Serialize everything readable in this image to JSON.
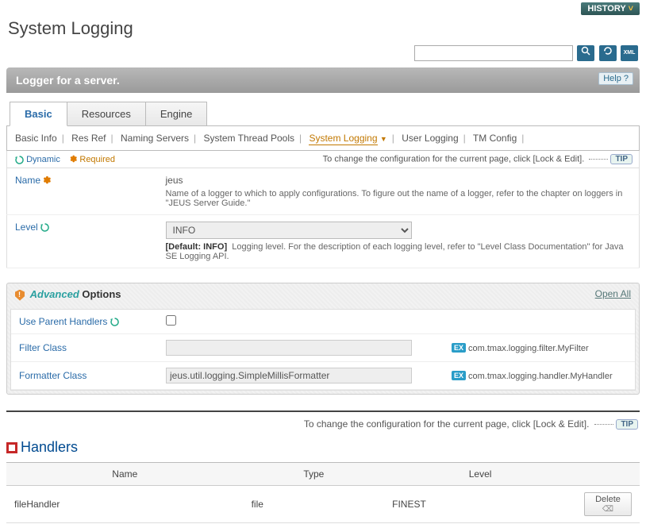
{
  "history_btn": "History",
  "page_title": "System Logging",
  "search": {
    "placeholder": ""
  },
  "panel": {
    "title": "Logger for a server.",
    "help_label": "Help ?"
  },
  "tabs": [
    "Basic",
    "Resources",
    "Engine"
  ],
  "subtabs": [
    "Basic Info",
    "Res Ref",
    "Naming Servers",
    "System Thread Pools",
    "System Logging",
    "User Logging",
    "TM Config"
  ],
  "legend": {
    "dynamic": "Dynamic",
    "required": "Required",
    "change_msg": "To change the configuration for the current page, click [Lock & Edit].",
    "tip": "TIP"
  },
  "form": {
    "name_label": "Name",
    "name_value": "jeus",
    "name_desc": "Name of a logger to which to apply configurations. To figure out the name of a logger, refer to the chapter on loggers in \"JEUS Server Guide.\"",
    "level_label": "Level",
    "level_value": "INFO",
    "level_default": "[Default: INFO]",
    "level_desc": "Logging level. For the description of each logging level, refer to \"Level Class Documentation\" for Java SE Logging API."
  },
  "advanced": {
    "title_adv": "Advanced",
    "title_opt": "Options",
    "open_all": "Open All",
    "use_parent_label": "Use Parent Handlers",
    "filter_class_label": "Filter Class",
    "filter_class_value": "",
    "filter_class_ex": "com.tmax.logging.filter.MyFilter",
    "formatter_class_label": "Formatter Class",
    "formatter_class_value": "jeus.util.logging.SimpleMillisFormatter",
    "formatter_class_ex": "com.tmax.logging.handler.MyHandler",
    "ex_label": "EX"
  },
  "handlers": {
    "title": "Handlers",
    "cols": [
      "Name",
      "Type",
      "Level",
      ""
    ],
    "rows": [
      {
        "name": "fileHandler",
        "type": "file",
        "level": "FINEST",
        "delete": "Delete"
      }
    ]
  }
}
